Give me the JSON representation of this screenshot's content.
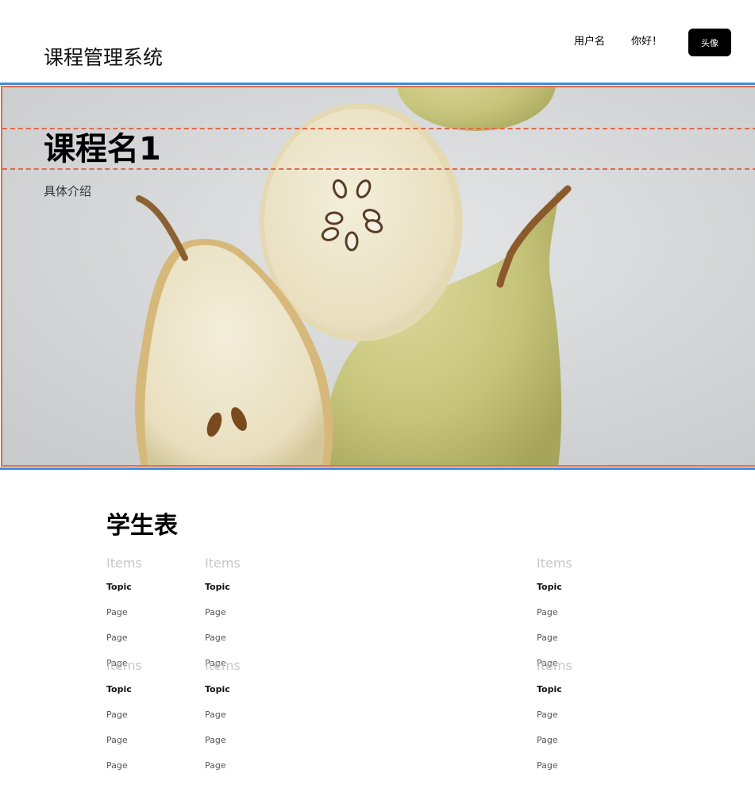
{
  "header": {
    "app_title": "课程管理系统",
    "username": "用户名",
    "greeting": "你好！",
    "avatar_label": "头像"
  },
  "hero": {
    "course_name": "课程名1",
    "description": "具体介绍",
    "image_icon": "pear-photo"
  },
  "student_table": {
    "title": "学生表",
    "groups": [
      {
        "columns": [
          {
            "header": "Items",
            "cells": [
              "Topic",
              "Page",
              "Page",
              "Page"
            ]
          },
          {
            "header": "Items",
            "cells": [
              "Topic",
              "Page",
              "Page",
              "Page"
            ]
          },
          {
            "header": "Items",
            "cells": [
              "Topic",
              "Page",
              "Page",
              "Page"
            ]
          }
        ]
      },
      {
        "columns": [
          {
            "header": "Items",
            "cells": [
              "Topic",
              "Page",
              "Page",
              "Page"
            ]
          },
          {
            "header": "Items",
            "cells": [
              "Topic",
              "Page",
              "Page",
              "Page"
            ]
          },
          {
            "header": "Items",
            "cells": [
              "Topic",
              "Page",
              "Page",
              "Page"
            ]
          }
        ]
      }
    ]
  },
  "colors": {
    "accent_blue": "#3b8fe0",
    "guide_orange": "#e0694b",
    "avatar_bg": "#000000"
  }
}
